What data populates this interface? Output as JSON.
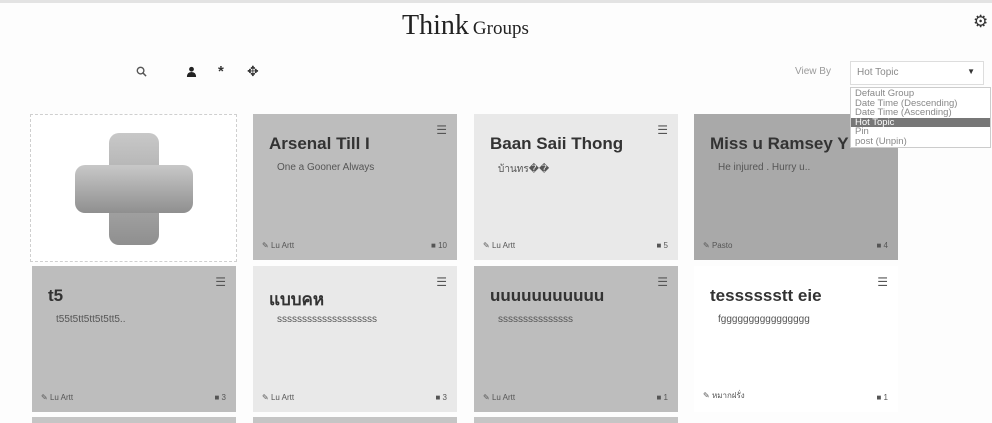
{
  "header": {
    "title_main": "Think",
    "title_sub": "Groups",
    "settings_icon": "gear-icon"
  },
  "toolbar": {
    "search_icon": "search-icon",
    "user_icon": "user-icon",
    "star_icon": "asterisk-icon",
    "move_icon": "move-icon"
  },
  "view_by": {
    "label": "View By",
    "selected": "Hot Topic",
    "options": [
      "Default Group",
      "Date Time (Descending)",
      "Date Time (Ascending)",
      "Hot Topic",
      "Pin",
      "post (Unpin)"
    ]
  },
  "groups": [
    {
      "name": "Arsenal Till I",
      "desc": "One a Gooner Always",
      "author": "Lu Artt",
      "count": "10"
    },
    {
      "name": "Baan Saii Thong",
      "desc": "บ้านทร��",
      "author": "Lu Artt",
      "count": "5"
    },
    {
      "name": "Miss u Ramsey Y",
      "desc": "He injured . Hurry u..",
      "author": "Pasto",
      "count": "4"
    },
    {
      "name": "t5",
      "desc": "t55t5tt5tt5t5tt5..",
      "author": "Lu Artt",
      "count": "3"
    },
    {
      "name": "แบบคห",
      "desc": "ssssssssssssssssssss",
      "author": "Lu Artt",
      "count": "3"
    },
    {
      "name": "uuuuuuuuuuu",
      "desc": "sssssssssssssss",
      "author": "Lu Artt",
      "count": "1"
    },
    {
      "name": "tesssssstt eie",
      "desc": "fgggggggggggggggg",
      "author": "หมากฝรั่ง",
      "count": "1"
    }
  ]
}
